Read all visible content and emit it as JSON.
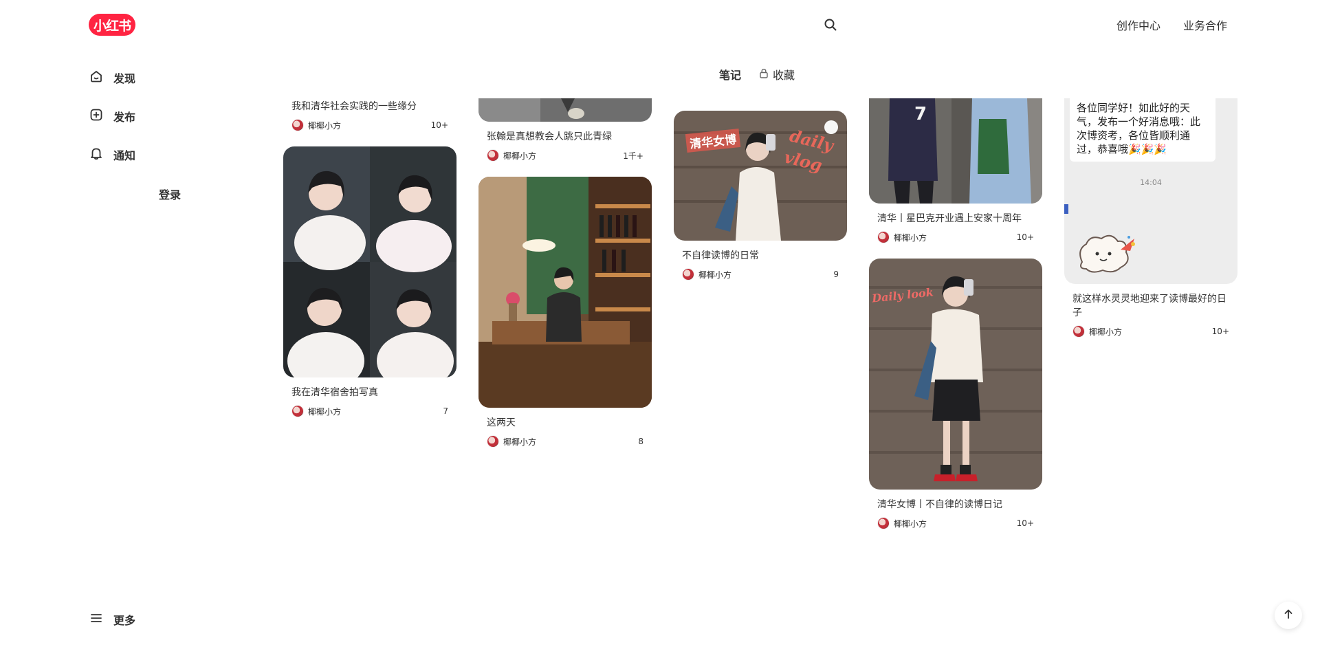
{
  "header": {
    "logo_text": "小红书",
    "creator_center": "创作中心",
    "business": "业务合作"
  },
  "sidebar": {
    "discover": "发现",
    "publish": "发布",
    "notify": "通知",
    "login": "登录",
    "more": "更多"
  },
  "tabs": {
    "notes": "笔记",
    "collect": "收藏"
  },
  "cards": [
    {
      "title": "我和清华社会实践的一些缘分",
      "author": "椰椰小方",
      "likes": "10+"
    },
    {
      "title": "我在清华宿舍拍写真",
      "author": "椰椰小方",
      "likes": "7"
    },
    {
      "title": "张翰是真想教会人跳只此青绿",
      "author": "椰椰小方",
      "likes": "1千+"
    },
    {
      "title": "这两天",
      "author": "椰椰小方",
      "likes": "8"
    },
    {
      "title": "不自律读博的日常",
      "author": "椰椰小方",
      "likes": "9",
      "overlay_left": "清华女博",
      "overlay_right": "daily vlog"
    },
    {
      "title": "清华丨星巴克开业遇上安家十周年",
      "author": "椰椰小方",
      "likes": "10+",
      "jersey": "7"
    },
    {
      "title": "清华女博丨不自律的读博日记",
      "author": "椰椰小方",
      "likes": "10+",
      "overlay_left": "Daily look"
    },
    {
      "title": "就这样水灵灵地迎来了读博最好的日子",
      "author": "椰椰小方",
      "likes": "10+",
      "chat_message": "各位同学好！如此好的天气，发布一个好消息哦：此次博资考，各位皆顺利通过，恭喜哦🎉🎉🎉",
      "chat_time": "14:04"
    }
  ],
  "colors": {
    "brand": "#ff2442",
    "text": "#333333"
  }
}
